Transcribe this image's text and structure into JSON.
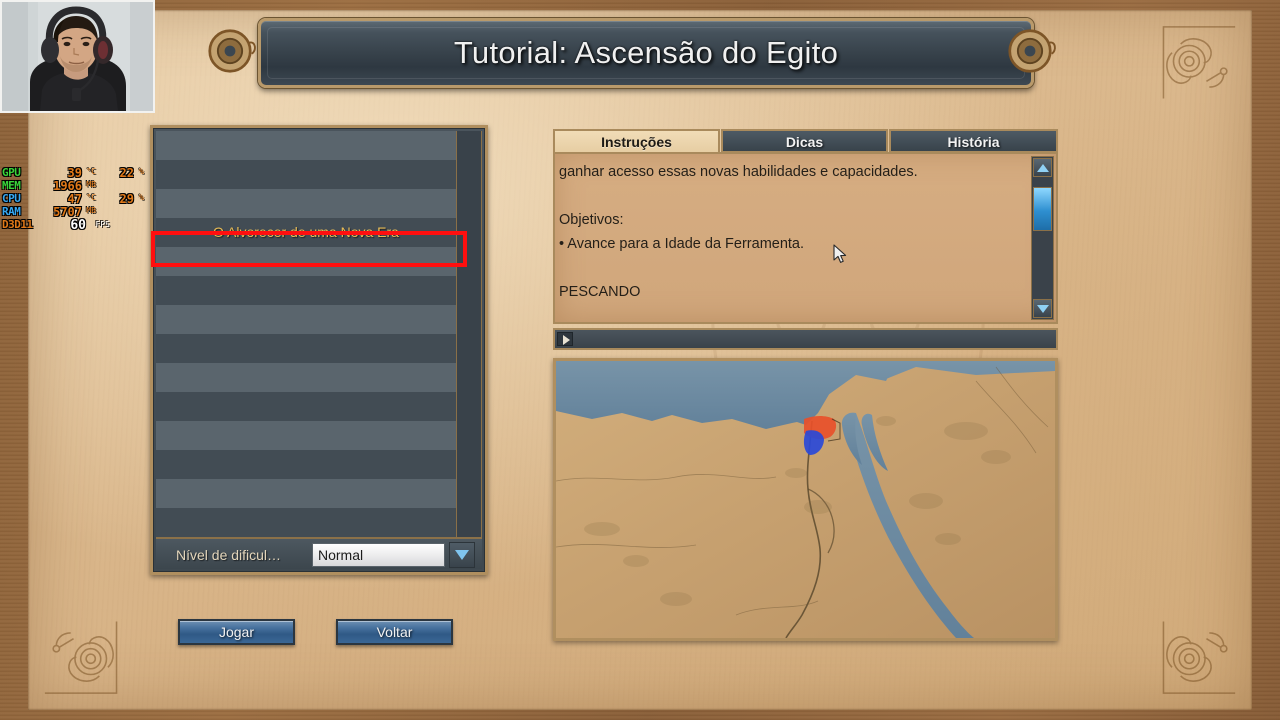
{
  "window": {
    "title": "Tutorial: Ascensão do Egito"
  },
  "scenario_list": {
    "rows": [
      {
        "label": "",
        "shade": "lo"
      },
      {
        "label": "",
        "shade": "hi"
      },
      {
        "label": "",
        "shade": "lo"
      },
      {
        "label": "O Alvorecer de uma Nova Era",
        "shade": "hi"
      },
      {
        "label": "",
        "shade": "lo"
      },
      {
        "label": "",
        "shade": "hi"
      },
      {
        "label": "",
        "shade": "lo"
      },
      {
        "label": "",
        "shade": "hi"
      },
      {
        "label": "",
        "shade": "lo"
      },
      {
        "label": "",
        "shade": "hi"
      },
      {
        "label": "",
        "shade": "lo"
      },
      {
        "label": "",
        "shade": "hi"
      },
      {
        "label": "",
        "shade": "lo"
      },
      {
        "label": "",
        "shade": "hi"
      }
    ],
    "selected_label": "O Alvorecer de uma Nova Era",
    "selected_index": 3,
    "highlight_color": "#ff0f0f"
  },
  "difficulty": {
    "label": "Nível de dificul…",
    "value": "Normal",
    "arrow_icon": "chevron-down-icon"
  },
  "buttons": {
    "play": "Jogar",
    "back": "Voltar"
  },
  "tabs": [
    {
      "label": "Instruções",
      "active": true
    },
    {
      "label": "Dicas",
      "active": false
    },
    {
      "label": "História",
      "active": false
    }
  ],
  "instructions": {
    "lines": [
      "ganhar acesso essas novas habilidades e capacidades.",
      "",
      "Objetivos:",
      "• Avance para a Idade da Ferramenta.",
      "",
      "PESCANDO"
    ],
    "scrollbar": {
      "up_icon": "triangle-up-icon",
      "down_icon": "triangle-down-icon",
      "thumb_position_percent": 18
    }
  },
  "audio_bar": {
    "play_icon": "play-icon"
  },
  "map": {
    "labels": [
      "",
      ""
    ],
    "water_color": "#6e8da3",
    "land_color": "#cdaa78",
    "player_red": "#e8502a",
    "player_blue": "#2a49d8"
  },
  "hardware_monitor": {
    "rows": [
      {
        "name": "GPU",
        "color": "#3ad43a",
        "value": "39",
        "unit": "°C",
        "value2": "22",
        "unit2": "%"
      },
      {
        "name": "MEM",
        "color": "#3ad43a",
        "value": "1966",
        "unit": "MB",
        "value2": "",
        "unit2": ""
      },
      {
        "name": "CPU",
        "color": "#35a7f0",
        "value": "47",
        "unit": "°C",
        "value2": "29",
        "unit2": "%"
      },
      {
        "name": "RAM",
        "color": "#35a7f0",
        "value": "5707",
        "unit": "MB",
        "value2": "",
        "unit2": ""
      }
    ],
    "fps_label": "D3D11",
    "fps_value": "60",
    "fps_unit": "FPS",
    "fps_color": "#e07818"
  },
  "webcam": {
    "present": true
  }
}
